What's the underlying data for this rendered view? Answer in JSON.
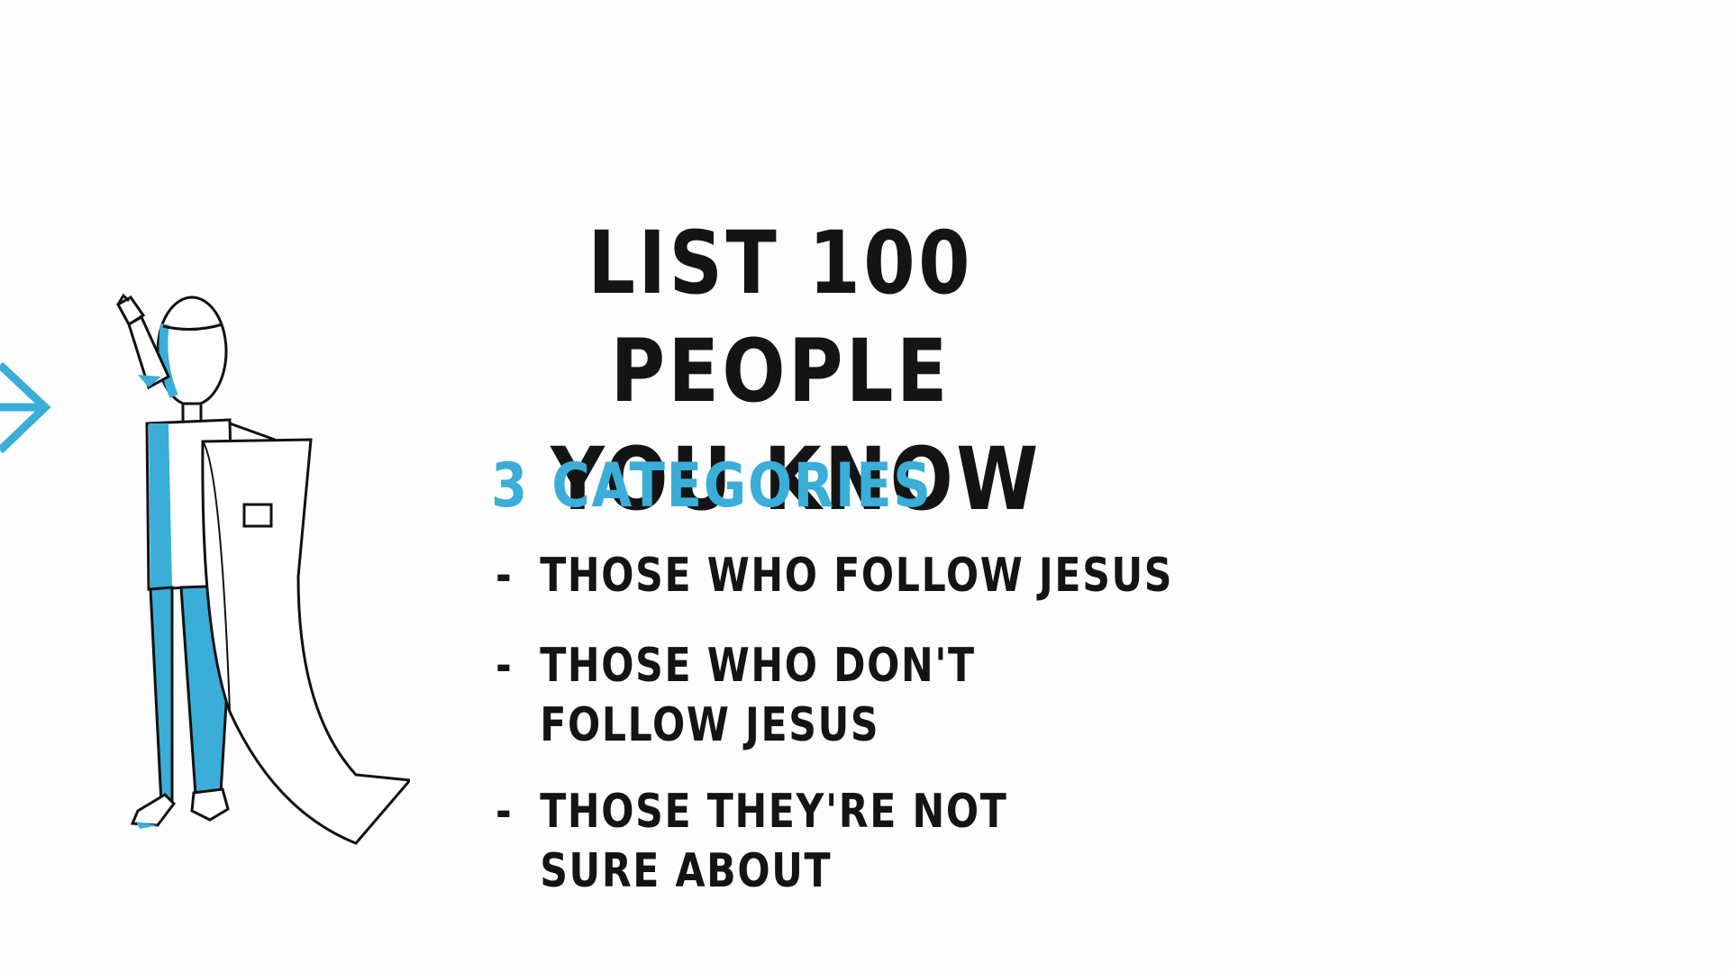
{
  "title": {
    "line1": "LIST 100 PEOPLE",
    "line2": "YOU KNOW"
  },
  "subtitle": {
    "number": "3",
    "label": "CATEGORIES"
  },
  "categories": [
    {
      "dash": "-",
      "lines": [
        "THOSE  WHO FOLLOW JESUS"
      ]
    },
    {
      "dash": "-",
      "lines": [
        "THOSE WHO DON'T",
        "FOLLOW JESUS"
      ]
    },
    {
      "dash": "-",
      "lines": [
        "THOSE  THEY'RE NOT",
        "SURE ABOUT"
      ]
    }
  ],
  "colors": {
    "background": "#fdfdfd",
    "ink": "#141414",
    "accent": "#3aaed8"
  },
  "illustration": {
    "figure": "person-holding-long-list-icon",
    "arrow": "arrow-right-icon"
  }
}
